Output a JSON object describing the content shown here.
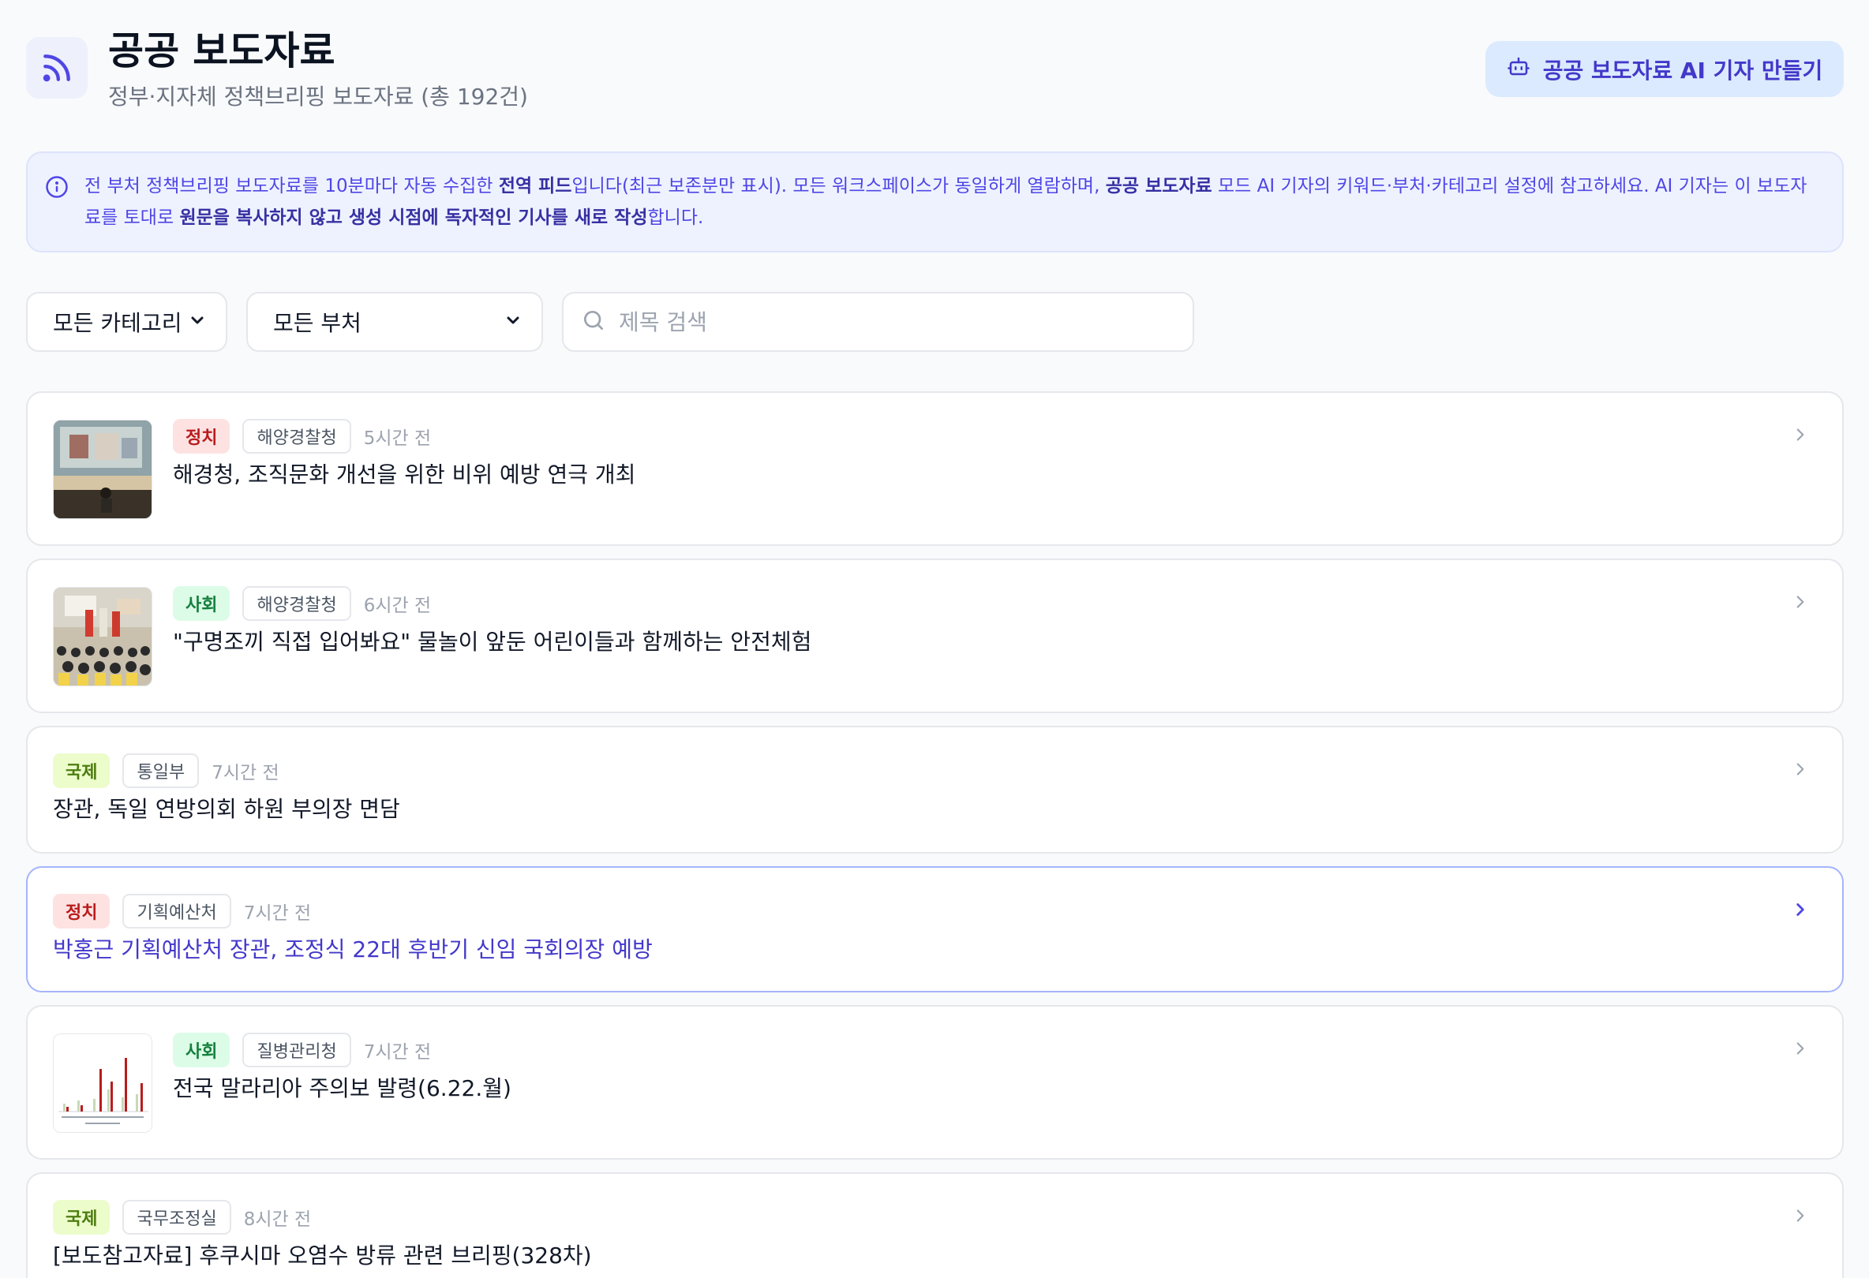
{
  "header": {
    "title": "공공 보도자료",
    "subtitle": "정부·지자체 정책브리핑 보도자료 (총 192건)",
    "ai_button_label": "공공 보도자료 AI 기자 만들기"
  },
  "notice": {
    "p1": "전 부처 정책브리핑 보도자료를 10분마다 자동 수집한 ",
    "b1": "전역 피드",
    "p2": "입니다(최근 보존분만 표시). 모든 워크스페이스가 동일하게 열람하며, ",
    "b2": "공공 보도자료",
    "p3": " 모드 AI 기자의 키워드·부처·카테고리 설정에 참고하세요. AI 기자는 이 보도자료를 토대로 ",
    "b3": "원문을 복사하지 않고 생성 시점에 독자적인 기사를 새로 작성",
    "p4": "합니다."
  },
  "filters": {
    "category_value": "모든 카테고리",
    "ministry_value": "모든 부처",
    "search_placeholder": "제목 검색",
    "search_value": ""
  },
  "items": [
    {
      "category": "정치",
      "ministry": "해양경찰청",
      "time": "5시간 전",
      "title": "해경청, 조직문화 개선을 위한 비위 예방 연극 개최",
      "thumbnail": "stage-photo"
    },
    {
      "category": "사회",
      "ministry": "해양경찰청",
      "time": "6시간 전",
      "title": "\"구명조끼 직접 입어봐요\" 물놀이 앞둔 어린이들과 함께하는 안전체험",
      "thumbnail": "children-photo"
    },
    {
      "category": "국제",
      "ministry": "통일부",
      "time": "7시간 전",
      "title": "장관, 독일 연방의회 하원 부의장 면담",
      "thumbnail": ""
    },
    {
      "category": "정치",
      "ministry": "기획예산처",
      "time": "7시간 전",
      "title": "박홍근 기획예산처 장관, 조정식 22대 후반기 신임 국회의장 예방",
      "thumbnail": ""
    },
    {
      "category": "사회",
      "ministry": "질병관리청",
      "time": "7시간 전",
      "title": "전국 말라리아 주의보 발령(6.22.월)",
      "thumbnail": "bar-chart-image"
    },
    {
      "category": "국제",
      "ministry": "국무조정실",
      "time": "8시간 전",
      "title": "[보도참고자료] 후쿠시마 오염수 방류 관련 브리핑(328차)",
      "thumbnail": ""
    }
  ],
  "colors": {
    "accent": "#4f46e5",
    "politics_tag": "#fee2e2",
    "society_tag": "#dcfce7",
    "international_tag": "#ecfccb"
  }
}
